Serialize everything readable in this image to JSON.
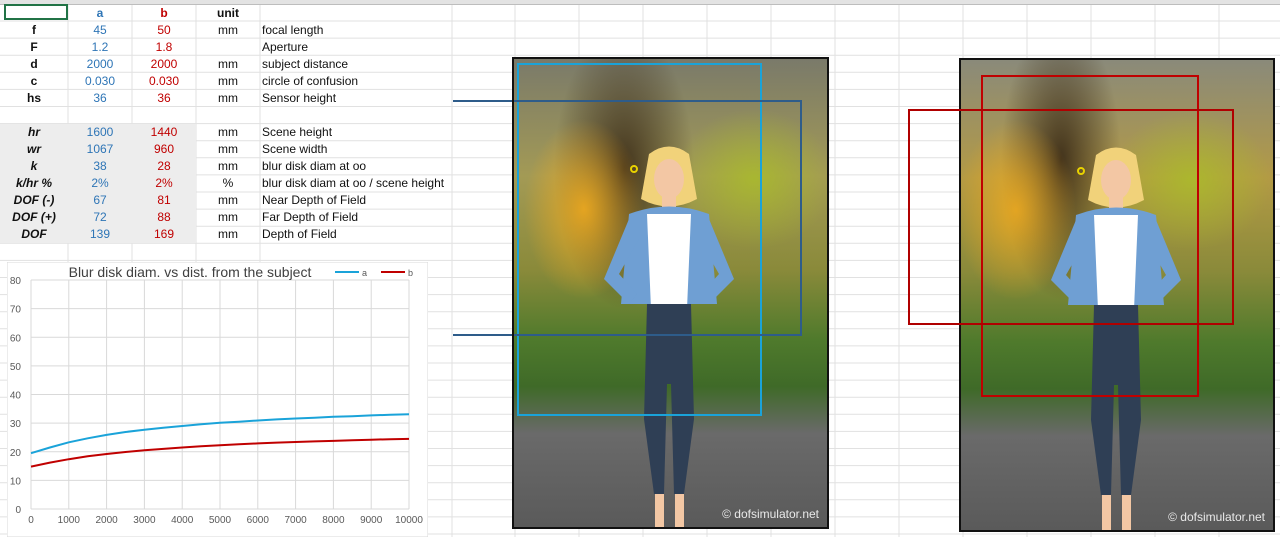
{
  "table": {
    "header": {
      "a": "a",
      "b": "b",
      "unit": "unit"
    },
    "rows": [
      {
        "label": "f",
        "a": "45",
        "b": "50",
        "unit": "mm",
        "desc": "focal length"
      },
      {
        "label": "F",
        "a": "1.2",
        "b": "1.8",
        "unit": "",
        "desc": "Aperture"
      },
      {
        "label": "d",
        "a": "2000",
        "b": "2000",
        "unit": "mm",
        "desc": "subject distance"
      },
      {
        "label": "c",
        "a": "0.030",
        "b": "0.030",
        "unit": "mm",
        "desc": "circle of confusion"
      },
      {
        "label": "hs",
        "a": "36",
        "b": "36",
        "unit": "mm",
        "desc": "Sensor height"
      },
      {
        "label": "hr",
        "a": "1600",
        "b": "1440",
        "unit": "mm",
        "desc": "Scene height"
      },
      {
        "label": "wr",
        "a": "1067",
        "b": "960",
        "unit": "mm",
        "desc": "Scene width"
      },
      {
        "label": "k",
        "a": "38",
        "b": "28",
        "unit": "mm",
        "desc": "blur disk diam at oo"
      },
      {
        "label": "k/hr %",
        "a": "2%",
        "b": "2%",
        "unit": "%",
        "desc": "blur disk diam at oo / scene height"
      },
      {
        "label": "DOF (-)",
        "a": "67",
        "b": "81",
        "unit": "mm",
        "desc": "Near Depth of Field"
      },
      {
        "label": "DOF (+)",
        "a": "72",
        "b": "88",
        "unit": "mm",
        "desc": "Far Depth of Field"
      },
      {
        "label": "DOF",
        "a": "139",
        "b": "169",
        "unit": "mm",
        "desc": "Depth of Field"
      }
    ]
  },
  "colors": {
    "a": "#2e75b6",
    "b": "#c00000",
    "series_a": "#1aa3d9",
    "series_b": "#c00000"
  },
  "photos": {
    "watermark": "© dofsimulator.net"
  },
  "chart_data": {
    "type": "line",
    "title": "Blur disk diam. vs dist. from the subject",
    "xlabel": "",
    "ylabel": "",
    "xlim": [
      0,
      10000
    ],
    "ylim": [
      0,
      80
    ],
    "x_ticks": [
      0,
      1000,
      2000,
      3000,
      4000,
      5000,
      6000,
      7000,
      8000,
      9000,
      10000
    ],
    "y_ticks": [
      0,
      10,
      20,
      30,
      40,
      50,
      60,
      70,
      80
    ],
    "grid": true,
    "legend": "top-right",
    "x": [
      0,
      500,
      1000,
      1500,
      2000,
      2500,
      3000,
      3500,
      4000,
      4500,
      5000,
      5500,
      6000,
      6500,
      7000,
      7500,
      8000,
      8500,
      9000,
      9500,
      10000
    ],
    "series": [
      {
        "name": "a",
        "values": [
          19.5,
          21.5,
          23.3,
          24.7,
          25.9,
          26.9,
          27.7,
          28.4,
          29.0,
          29.6,
          30.1,
          30.5,
          30.9,
          31.3,
          31.6,
          31.9,
          32.2,
          32.4,
          32.7,
          32.9,
          33.1
        ]
      },
      {
        "name": "b",
        "values": [
          14.8,
          16.2,
          17.4,
          18.4,
          19.2,
          19.9,
          20.5,
          21.0,
          21.5,
          21.9,
          22.3,
          22.6,
          22.9,
          23.2,
          23.4,
          23.6,
          23.8,
          24.0,
          24.2,
          24.4,
          24.5
        ]
      }
    ]
  }
}
